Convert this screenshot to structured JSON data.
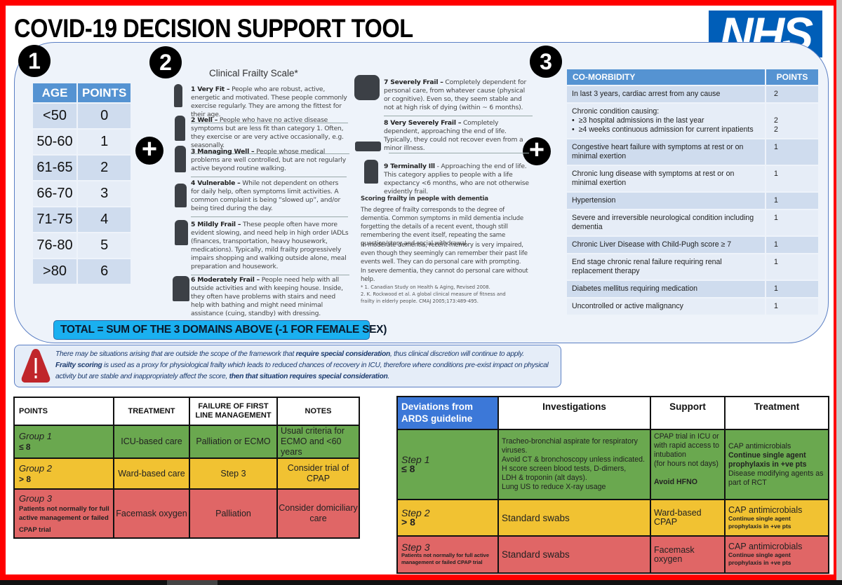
{
  "title": "COVID-19 DECISION SUPPORT TOOL",
  "logo": "NHS",
  "colors": {
    "frame": "#ff0000",
    "nhs_blue": "#005eb8",
    "header_blue": "#5593d2",
    "green": "#6aa84f",
    "amber": "#f1c232",
    "red": "#e06666",
    "total_bar": "#1ab0f0",
    "ards_header": "#3c78d8"
  },
  "badges": [
    "1",
    "2",
    "3"
  ],
  "age_table": {
    "headers": [
      "AGE",
      "POINTS"
    ],
    "rows": [
      [
        "<50",
        "0"
      ],
      [
        "50-60",
        "1"
      ],
      [
        "61-65",
        "2"
      ],
      [
        "66-70",
        "3"
      ],
      [
        "71-75",
        "4"
      ],
      [
        "76-80",
        "5"
      ],
      [
        ">80",
        "6"
      ]
    ]
  },
  "frailty": {
    "title": "Clinical Frailty Scale*",
    "items": [
      {
        "head": "1  Very Fit –",
        "text": " People who are robust, active, energetic and motivated.  These people commonly exercise regularly.  They are among the fittest for their age."
      },
      {
        "head": "2  Well –",
        "text": "  People who have no active disease symptoms but are less fit than category 1. Often, they exercise or are very active occasionally, e.g. seasonally."
      },
      {
        "head": "3  Managing Well –",
        "text": " People whose medical problems are well controlled, but are not regularly active beyond routine walking."
      },
      {
        "head": "4  Vulnerable –",
        "text": " While not dependent on others for daily help, often symptoms limit activities. A common complaint is being “slowed up”, and/or being tired during the day."
      },
      {
        "head": "5  Mildly Frail –",
        "text": "  These people often have more evident slowing, and need help in high order IADLs (finances, transportation, heavy housework, medications).  Typically, mild frailty progressively impairs shopping and walking outside alone, meal preparation and housework."
      },
      {
        "head": "6  Moderately Frail –",
        "text": " People need help with all outside activities and with keeping house. Inside, they often have problems with stairs and need help with bathing and might need minimal assistance (cuing, standby) with dressing."
      },
      {
        "head": "7  Severely Frail –",
        "text": " Completely dependent for personal care, from whatever cause (physical or cognitive).  Even so, they seem stable and not at high risk of dying (within ~ 6 months)."
      },
      {
        "head": "8  Very Severely Frail –",
        "text": " Completely dependent, approaching the end of life. Typically, they could not recover even from a minor illness."
      },
      {
        "head": "9  Terminally Ill",
        "text": " - Approaching the end of life. This category applies to people with a life expectancy <6 months, who are not otherwise evidently frail."
      }
    ],
    "dementia_title": "Scoring frailty in people with dementia",
    "dementia_p1": "The degree of frailty corresponds to the degree of dementia. Common symptoms in mild dementia include forgetting the details of a recent event, though still remembering the event itself, repeating the same question/story and social withdrawal.",
    "dementia_p2": "In moderate dementia, recent memory is very impaired, even though they seemingly can remember their past life events well. They can do personal care with prompting.",
    "dementia_p3": "In severe dementia, they cannot do personal care without help.",
    "ref1": "* 1. Canadian Study on Health & Aging, Revised 2008.",
    "ref2": "2. K. Rockwood et al. A global clinical measure of fitness and",
    "ref3": "frailty in elderly people. CMAJ 2005;173:489-495."
  },
  "comorbidity": {
    "headers": [
      "CO-MORBIDITY",
      "POINTS"
    ],
    "rows": [
      {
        "desc": "In last 3 years, cardiac arrest from any cause",
        "pts": "2"
      },
      {
        "desc": "Chronic condition causing:",
        "bullets": [
          "≥3 hospital admissions in the last year",
          "≥4 weeks continuous admission for current inpatients"
        ],
        "pts": "2",
        "pts2": "2"
      },
      {
        "desc": "Congestive heart failure with symptoms at rest or on minimal exertion",
        "pts": "1"
      },
      {
        "desc": "Chronic lung disease with symptoms at rest or on minimal exertion",
        "pts": "1"
      },
      {
        "desc": "Hypertension",
        "pts": "1"
      },
      {
        "desc": "Severe and irreversible neurological condition including dementia",
        "pts": "1"
      },
      {
        "desc": "Chronic Liver Disease with Child-Pugh score ≥ 7",
        "pts": "1"
      },
      {
        "desc": "End stage chronic renal failure requiring renal replacement therapy",
        "pts": "1"
      },
      {
        "desc": "Diabetes mellitus requiring medication",
        "pts": "1"
      },
      {
        "desc": "Uncontrolled or active malignancy",
        "pts": "1"
      }
    ]
  },
  "total": "TOTAL = SUM OF THE 3 DOMAINS ABOVE (-1 FOR FEMALE SEX)",
  "warning": {
    "line1_a": "There may be situations arising that are outside the scope of the framework that ",
    "line1_b": "require special consideration",
    "line1_c": ", thus clinical discretion will continue to apply.",
    "line2_a": "Frailty scoring",
    "line2_b": " is used as a proxy for physiological frailty which leads to reduced chances of recovery in ICU, therefore where conditions pre-exist impact on physical activity but are stable and inappropriately affect the score, ",
    "line2_c": "then that situation requires special consideration",
    "line2_d": "."
  },
  "management_table": {
    "headers": [
      "POINTS",
      "TREATMENT",
      "FAILURE OF FIRST LINE MANAGEMENT",
      "NOTES"
    ],
    "rows": [
      {
        "group": "Group 1",
        "score": "≤ 8",
        "treatment": "ICU-based care",
        "failure": "Palliation or ECMO",
        "notes": "Usual criteria for ECMO and <60 years"
      },
      {
        "group": "Group 2",
        "score": "> 8",
        "treatment": "Ward-based care",
        "failure": "Step 3",
        "notes": "Consider trial of CPAP"
      },
      {
        "group": "Group 3",
        "score": "Patients not normally for full active management or failed",
        "score2": "CPAP trial",
        "treatment": "Facemask oxygen",
        "failure": "Palliation",
        "notes": "Consider domiciliary care"
      }
    ]
  },
  "ards_table": {
    "headers": [
      "Deviations from ARDS guideline",
      "Investigations",
      "Support",
      "Treatment"
    ],
    "rows": [
      {
        "step": "Step 1",
        "score": "≤ 8",
        "investigations": [
          "Tracheo-bronchial aspirate for respiratory viruses.",
          "Avoid CT & bronchoscopy unless indicated.",
          "H score screen blood tests, D-dimers,",
          "LDH & troponin (alt days).",
          "Lung US to reduce X-ray usage"
        ],
        "support": [
          "CPAP trial in ICU or with rapid access to intubation",
          "(for hours not days)"
        ],
        "support_bold": "Avoid HFNO",
        "treatment": "CAP antimicrobials",
        "treatment_bold": "Continue single agent prophylaxis in +ve pts",
        "treatment_extra": "Disease modifying agents as part of RCT"
      },
      {
        "step": "Step 2",
        "score": "> 8",
        "investigations": [
          "Standard swabs"
        ],
        "support": [
          "Ward-based CPAP"
        ],
        "treatment": "CAP antimicrobials",
        "treatment_bold": "Continue single agent prophylaxis in +ve pts"
      },
      {
        "step": "Step 3",
        "score": "Patients not normally for full active management or failed CPAP trial",
        "investigations": [
          "Standard swabs"
        ],
        "support": [
          "Facemask oxygen"
        ],
        "treatment": "CAP antimicrobials",
        "treatment_bold": "Continue single agent prophylaxis in +ve pts"
      }
    ]
  }
}
